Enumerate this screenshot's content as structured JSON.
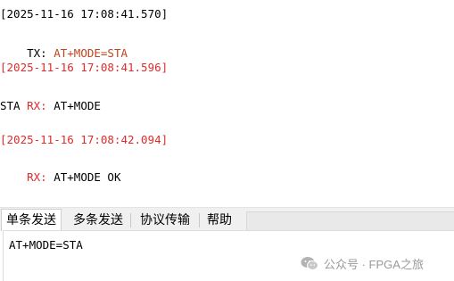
{
  "log": {
    "entries": [
      {
        "timestamp": "[2025-11-16 17:08:41.570]",
        "direction": "TX:",
        "lines": [
          "AT+MODE=STA"
        ]
      },
      {
        "timestamp": "[2025-11-16 17:08:41.596]",
        "direction": "RX:",
        "lines": [
          "AT+MODE",
          "STA"
        ]
      },
      {
        "timestamp": "[2025-11-16 17:08:42.094]",
        "direction": "RX:",
        "lines": [
          "AT+MODE OK"
        ]
      }
    ]
  },
  "tabs": [
    {
      "label": "单条发送",
      "active": true
    },
    {
      "label": "多条发送",
      "active": false
    },
    {
      "label": "协议传输",
      "active": false
    },
    {
      "label": "帮助",
      "active": false
    }
  ],
  "input": {
    "value": "AT+MODE=STA"
  },
  "watermark": {
    "text": "公众号 · FPGA之旅",
    "icon": "wechat-icon"
  },
  "colors": {
    "tx_command": "#c0451f",
    "rx_red": "#e02b2b",
    "tab_bg": "#f0f0f0"
  }
}
